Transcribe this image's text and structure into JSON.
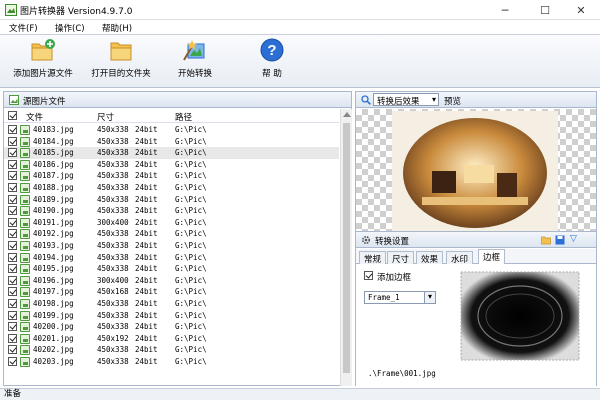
{
  "window": {
    "title": "图片转换器 Version4.9.7.0",
    "minimize_glyph": "─",
    "maximize_glyph": "☐",
    "close_glyph": "✕"
  },
  "menu": [
    "文件(F)",
    "操作(C)",
    "帮助(H)"
  ],
  "toolbar": {
    "add_source": "添加图片源文件",
    "open_dest": "打开目的文件夹",
    "start": "开始转换",
    "help": "帮 助"
  },
  "source_panel": {
    "title": "源图片文件",
    "columns": {
      "file": "文件",
      "size": "尺寸",
      "path": "路径"
    },
    "rows": [
      {
        "name": "40183.jpg",
        "size": "450x338",
        "bit": "24bit",
        "path": "G:\\Pic\\"
      },
      {
        "name": "40184.jpg",
        "size": "450x338",
        "bit": "24bit",
        "path": "G:\\Pic\\"
      },
      {
        "name": "40185.jpg",
        "size": "450x338",
        "bit": "24bit",
        "path": "G:\\Pic\\"
      },
      {
        "name": "40186.jpg",
        "size": "450x338",
        "bit": "24bit",
        "path": "G:\\Pic\\"
      },
      {
        "name": "40187.jpg",
        "size": "450x338",
        "bit": "24bit",
        "path": "G:\\Pic\\"
      },
      {
        "name": "40188.jpg",
        "size": "450x338",
        "bit": "24bit",
        "path": "G:\\Pic\\"
      },
      {
        "name": "40189.jpg",
        "size": "450x338",
        "bit": "24bit",
        "path": "G:\\Pic\\"
      },
      {
        "name": "40190.jpg",
        "size": "450x338",
        "bit": "24bit",
        "path": "G:\\Pic\\"
      },
      {
        "name": "40191.jpg",
        "size": "300x400",
        "bit": "24bit",
        "path": "G:\\Pic\\"
      },
      {
        "name": "40192.jpg",
        "size": "450x338",
        "bit": "24bit",
        "path": "G:\\Pic\\"
      },
      {
        "name": "40193.jpg",
        "size": "450x338",
        "bit": "24bit",
        "path": "G:\\Pic\\"
      },
      {
        "name": "40194.jpg",
        "size": "450x338",
        "bit": "24bit",
        "path": "G:\\Pic\\"
      },
      {
        "name": "40195.jpg",
        "size": "450x338",
        "bit": "24bit",
        "path": "G:\\Pic\\"
      },
      {
        "name": "40196.jpg",
        "size": "300x400",
        "bit": "24bit",
        "path": "G:\\Pic\\"
      },
      {
        "name": "40197.jpg",
        "size": "450x168",
        "bit": "24bit",
        "path": "G:\\Pic\\"
      },
      {
        "name": "40198.jpg",
        "size": "450x338",
        "bit": "24bit",
        "path": "G:\\Pic\\"
      },
      {
        "name": "40199.jpg",
        "size": "450x338",
        "bit": "24bit",
        "path": "G:\\Pic\\"
      },
      {
        "name": "40200.jpg",
        "size": "450x338",
        "bit": "24bit",
        "path": "G:\\Pic\\"
      },
      {
        "name": "40201.jpg",
        "size": "450x192",
        "bit": "24bit",
        "path": "G:\\Pic\\"
      },
      {
        "name": "40202.jpg",
        "size": "450x338",
        "bit": "24bit",
        "path": "G:\\Pic\\"
      },
      {
        "name": "40203.jpg",
        "size": "450x338",
        "bit": "24bit",
        "path": "G:\\Pic\\"
      }
    ],
    "selected_row": 2
  },
  "preview_panel": {
    "mode": "转换后效果",
    "label": "预览"
  },
  "settings_panel": {
    "title": "转换设置",
    "tabs": [
      "常规",
      "尺寸",
      "效果",
      "水印",
      "边框"
    ],
    "active_tab": 4,
    "add_border_label": "添加边框",
    "add_border_checked": true,
    "frame_select": "Frame_1",
    "frame_path": ".\\Frame\\001.jpg"
  },
  "status": "准备",
  "colors": {
    "accent_blue": "#2b6fd6",
    "folder_yellow": "#f2c14e",
    "panel_border": "#a9b8cc"
  }
}
